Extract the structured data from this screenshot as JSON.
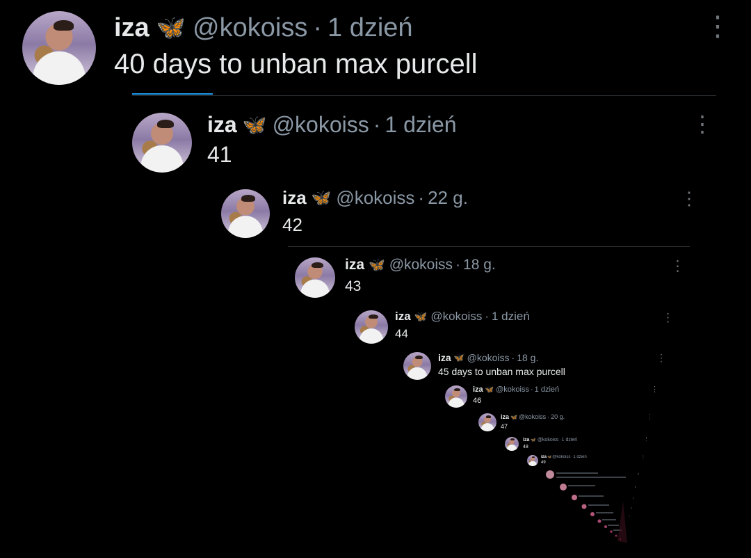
{
  "tweets": [
    {
      "name": "iza",
      "handle": "@kokoiss",
      "sep": "·",
      "time": "1 dzień",
      "text": "40 days to unban max purcell"
    },
    {
      "name": "iza",
      "handle": "@kokoiss",
      "sep": "·",
      "time": "1 dzień",
      "text": "41"
    },
    {
      "name": "iza",
      "handle": "@kokoiss",
      "sep": "·",
      "time": "22 g.",
      "text": "42"
    },
    {
      "name": "iza",
      "handle": "@kokoiss",
      "sep": "·",
      "time": "18 g.",
      "text": "43"
    },
    {
      "name": "iza",
      "handle": "@kokoiss",
      "sep": "·",
      "time": "1 dzień",
      "text": "44"
    },
    {
      "name": "iza",
      "handle": "@kokoiss",
      "sep": "·",
      "time": "18 g.",
      "text": "45 days to unban max purcell"
    },
    {
      "name": "iza",
      "handle": "@kokoiss",
      "sep": "·",
      "time": "1 dzień",
      "text": "46"
    },
    {
      "name": "iza",
      "handle": "@kokoiss",
      "sep": "·",
      "time": "20 g.",
      "text": "47"
    },
    {
      "name": "iza",
      "handle": "@kokoiss",
      "sep": "·",
      "time": "1 dzień",
      "text": "48"
    },
    {
      "name": "iza",
      "handle": "@kokoiss",
      "sep": "·",
      "time": "1 dzień",
      "text": "49"
    }
  ],
  "icons": {
    "butterfly": "🦋",
    "more": "⋮"
  },
  "colors": {
    "background": "#000000",
    "text": "#e7e9ea",
    "secondary": "#8b98a5",
    "accent": "#1d9bf0"
  }
}
